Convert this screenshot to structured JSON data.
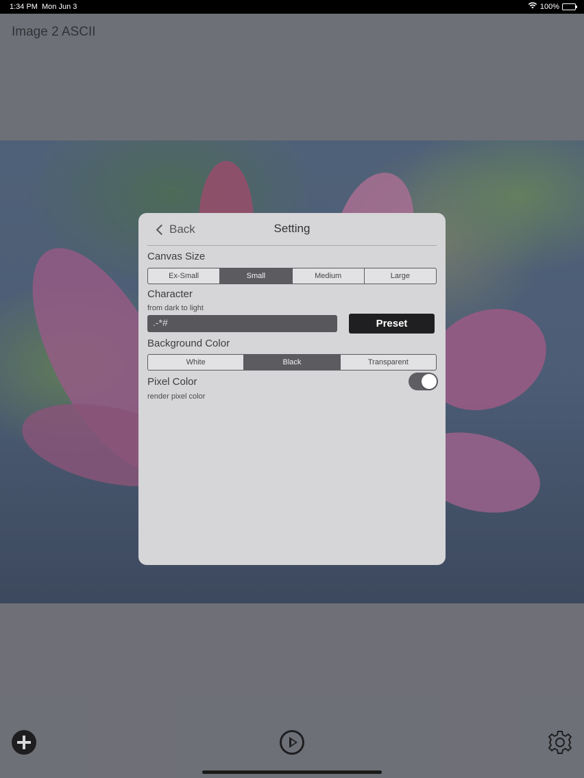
{
  "status_bar": {
    "time": "1:34 PM",
    "date": "Mon Jun 3",
    "battery": "100%",
    "icons": [
      "wifi-icon",
      "battery-icon"
    ]
  },
  "app": {
    "title": "Image 2 ASCII"
  },
  "settings_modal": {
    "back_label": "Back",
    "title": "Setting",
    "canvas_size": {
      "label": "Canvas Size",
      "options": [
        "Ex-Small",
        "Small",
        "Medium",
        "Large"
      ],
      "selected": "Small"
    },
    "character": {
      "label": "Character",
      "sublabel": "from dark to light",
      "value": ".-*#",
      "preset_label": "Preset"
    },
    "background_color": {
      "label": "Background Color",
      "options": [
        "White",
        "Black",
        "Transparent"
      ],
      "selected": "Black"
    },
    "pixel_color": {
      "label": "Pixel Color",
      "sublabel": "render pixel color",
      "enabled": true
    }
  },
  "toolbar": {
    "icons": [
      "add-icon",
      "play-icon",
      "gear-icon"
    ]
  },
  "colors": {
    "selected_segment": "#5c5c60",
    "preset_button": "#1f1f21",
    "modal_background": "#d6d5d8"
  }
}
